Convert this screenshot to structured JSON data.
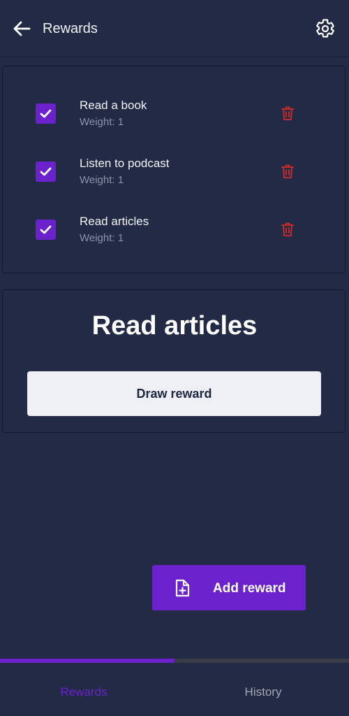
{
  "header": {
    "title": "Rewards",
    "back_icon": "arrow-left-icon",
    "settings_icon": "gear-icon"
  },
  "rewards": [
    {
      "name": "Read a book",
      "weight": "Weight: 1",
      "checked": true
    },
    {
      "name": "Listen to podcast",
      "weight": "Weight: 1",
      "checked": true
    },
    {
      "name": "Read articles",
      "weight": "Weight: 1",
      "checked": true
    }
  ],
  "result": {
    "title": "Read articles",
    "draw_label": "Draw reward"
  },
  "fab": {
    "label": "Add reward",
    "icon": "file-plus-icon"
  },
  "tabs": [
    {
      "label": "Rewards",
      "active": true
    },
    {
      "label": "History",
      "active": false
    }
  ],
  "colors": {
    "background": "#222a45",
    "accent": "#6b22cc",
    "danger": "#d42a2a",
    "muted_text": "#8c93a8"
  }
}
